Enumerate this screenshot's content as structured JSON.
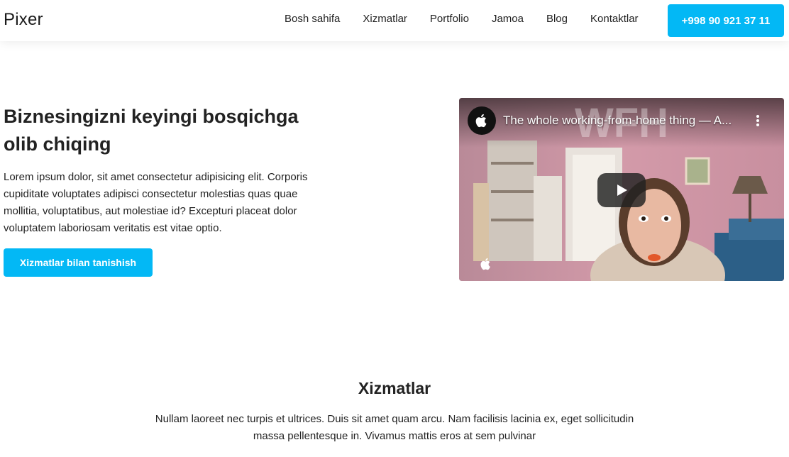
{
  "header": {
    "logo": "Pixer",
    "nav": [
      "Bosh sahifa",
      "Xizmatlar",
      "Portfolio",
      "Jamoa",
      "Blog",
      "Kontaktlar"
    ],
    "phone": "+998 90 921 37 11"
  },
  "hero": {
    "title": "Biznesingizni keyingi bosqichga olib chiqing",
    "text": "Lorem ipsum dolor, sit amet consectetur adipisicing elit. Corporis cupiditate voluptates adipisci consectetur molestias quas quae mollitia, voluptatibus, aut molestiae id? Excepturi placeat dolor voluptatem laboriosam veritatis est vitae optio.",
    "button": "Xizmatlar bilan tanishish"
  },
  "video": {
    "title": "The whole working-from-home thing — A...",
    "overlay_text": "WFH",
    "channel_icon": "apple-logo-icon",
    "menu_icon": "kebab-menu-icon",
    "play_icon": "play-icon",
    "corner_icon": "apple-logo-icon"
  },
  "services": {
    "title": "Xizmatlar",
    "text": "Nullam laoreet nec turpis et ultrices. Duis sit amet quam arcu. Nam facilisis lacinia ex, eget sollicitudin massa pellentesque in. Vivamus mattis eros at sem pulvinar"
  },
  "colors": {
    "accent": "#03b8f5",
    "text": "#222222"
  }
}
